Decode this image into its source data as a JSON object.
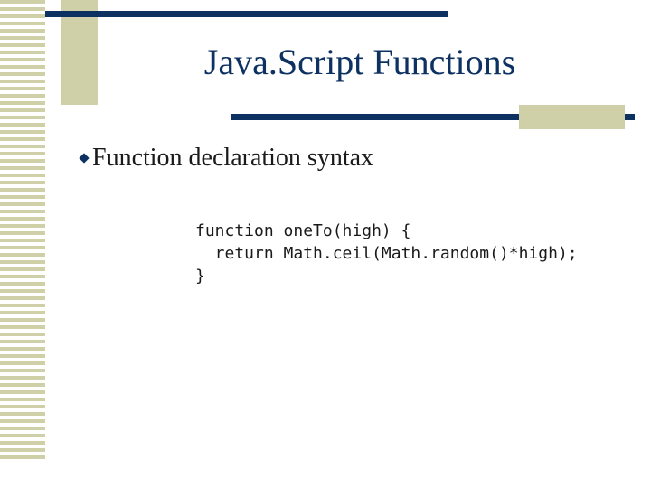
{
  "slide": {
    "title": "Java.Script Functions",
    "bullet": "Function declaration syntax",
    "code_lines": [
      "function oneTo(high) {",
      "  return Math.ceil(Math.random()*high);",
      "}"
    ]
  },
  "colors": {
    "title": "#0d3262",
    "accent_rule": "#0d3262",
    "decor_khaki": "#cfcfa8",
    "text": "#1a1a1a"
  },
  "icons": {
    "bullet": "diamond-bullet-icon"
  }
}
